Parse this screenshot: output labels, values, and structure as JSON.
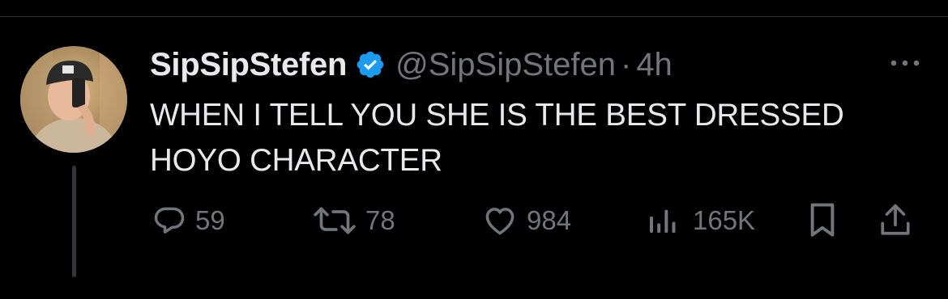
{
  "author": {
    "display_name": "SipSipStefen",
    "handle": "@SipSipStefen",
    "separator": "·",
    "timestamp": "4h",
    "verified": true,
    "verified_color": "#1d9bf0"
  },
  "tweet": {
    "text": "WHEN I TELL YOU SHE IS THE BEST DRESSED HOYO CHARACTER"
  },
  "actions": {
    "replies": "59",
    "reposts": "78",
    "likes": "984",
    "views": "165K"
  },
  "icons": {
    "more": "more-icon",
    "reply": "reply-icon",
    "repost": "repost-icon",
    "like": "heart-icon",
    "views": "views-icon",
    "bookmark": "bookmark-icon",
    "share": "share-icon"
  },
  "colors": {
    "background": "#000000",
    "text_primary": "#e7e9ea",
    "text_secondary": "#71767b"
  }
}
